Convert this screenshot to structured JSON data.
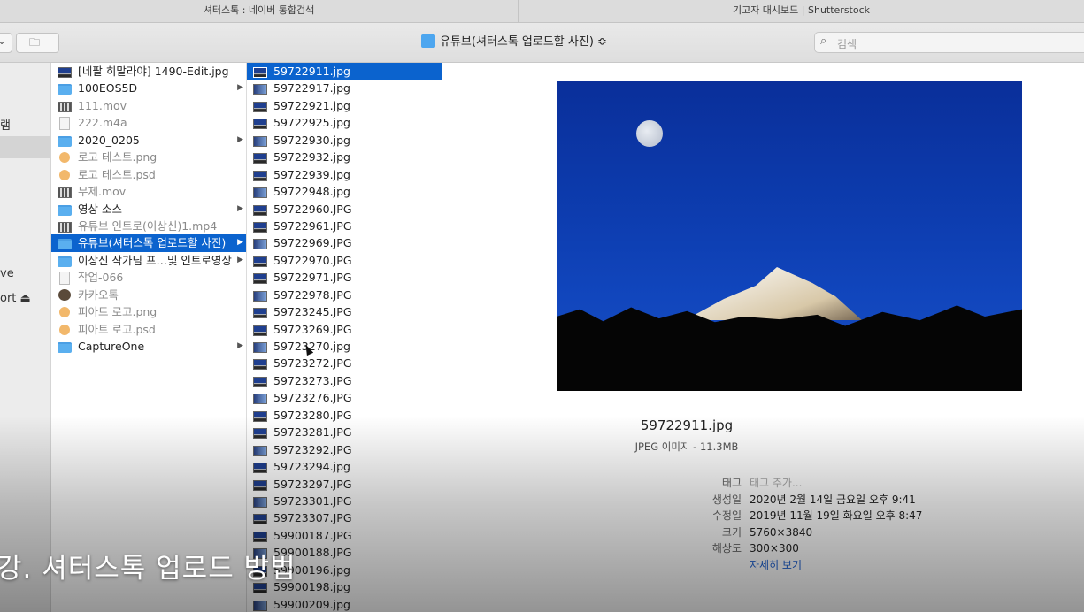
{
  "tabs": [
    {
      "label": "셔터스톡 : 네이버 통합검색"
    },
    {
      "label": "기고자 대시보드 | Shutterstock"
    }
  ],
  "toolbar": {
    "path_label": "유튜브(셔터스톡 업로드할 사진) ≎",
    "search_placeholder": "검색"
  },
  "sidebar": {
    "items": [
      {
        "label": "램"
      },
      {
        "label": "ve"
      },
      {
        "label": "ort ⏏"
      }
    ]
  },
  "column1": {
    "items": [
      {
        "label": "[네팔 히말라야] 1490-Edit.jpg",
        "icon": "image-icon",
        "dim": false,
        "folder": false
      },
      {
        "label": "100EOS5D",
        "icon": "folder-icon",
        "dim": false,
        "folder": true
      },
      {
        "label": "111.mov",
        "icon": "video-icon",
        "dim": true,
        "folder": false
      },
      {
        "label": "222.m4a",
        "icon": "document-icon",
        "dim": true,
        "folder": false
      },
      {
        "label": "2020_0205",
        "icon": "folder-icon",
        "dim": false,
        "folder": true
      },
      {
        "label": "로고 테스트.png",
        "icon": "logo-icon",
        "dim": true,
        "folder": false
      },
      {
        "label": "로고 테스트.psd",
        "icon": "logo-icon",
        "dim": true,
        "folder": false
      },
      {
        "label": "무제.mov",
        "icon": "video-icon",
        "dim": true,
        "folder": false
      },
      {
        "label": "영상 소스",
        "icon": "folder-icon",
        "dim": false,
        "folder": true
      },
      {
        "label": "유튜브 인트로(이상신)1.mp4",
        "icon": "video-icon",
        "dim": true,
        "folder": false
      },
      {
        "label": "유튜브(셔터스톡 업로드할 사진)",
        "icon": "folder-icon",
        "dim": false,
        "folder": true,
        "selected": true
      },
      {
        "label": "이상신 작가님 프…및 인트로영상",
        "icon": "folder-icon",
        "dim": false,
        "folder": true
      },
      {
        "label": "작업-066",
        "icon": "document-icon",
        "dim": true,
        "folder": false
      },
      {
        "label": "카카오톡",
        "icon": "talk-icon",
        "dim": true,
        "folder": false
      },
      {
        "label": "피아트 로고.png",
        "icon": "logo-icon",
        "dim": true,
        "folder": false
      },
      {
        "label": "피아트 로고.psd",
        "icon": "logo-icon",
        "dim": true,
        "folder": false
      },
      {
        "label": "CaptureOne",
        "icon": "folder-icon",
        "dim": false,
        "folder": true
      }
    ]
  },
  "column2": {
    "items": [
      "59722911.jpg",
      "59722917.jpg",
      "59722921.jpg",
      "59722925.jpg",
      "59722930.jpg",
      "59722932.jpg",
      "59722939.jpg",
      "59722948.jpg",
      "59722960.JPG",
      "59722961.JPG",
      "59722969.JPG",
      "59722970.JPG",
      "59722971.JPG",
      "59722978.JPG",
      "59723245.JPG",
      "59723269.JPG",
      "59723270.jpg",
      "59723272.JPG",
      "59723273.JPG",
      "59723276.JPG",
      "59723280.JPG",
      "59723281.JPG",
      "59723292.JPG",
      "59723294.jpg",
      "59723297.JPG",
      "59723301.JPG",
      "59723307.JPG",
      "59900187.JPG",
      "59900188.JPG",
      "59900196.jpg",
      "59900198.jpg",
      "59900209.jpg"
    ],
    "selected_index": 0
  },
  "preview": {
    "filename": "59722911.jpg",
    "kind_size": "JPEG 이미지 - 11.3MB",
    "meta": [
      {
        "key": "태그",
        "value": "태그 추가...",
        "style": "ph"
      },
      {
        "key": "생성일",
        "value": "2020년 2월 14일 금요일 오후 9:41",
        "style": ""
      },
      {
        "key": "수정일",
        "value": "2019년 11월 19일 화요일 오후 8:47",
        "style": ""
      },
      {
        "key": "크기",
        "value": "5760×3840",
        "style": ""
      },
      {
        "key": "해상도",
        "value": "300×300",
        "style": ""
      },
      {
        "key": "",
        "value": "자세히 보기",
        "style": "link"
      }
    ]
  },
  "caption": "강. 셔터스톡 업로드 방법"
}
